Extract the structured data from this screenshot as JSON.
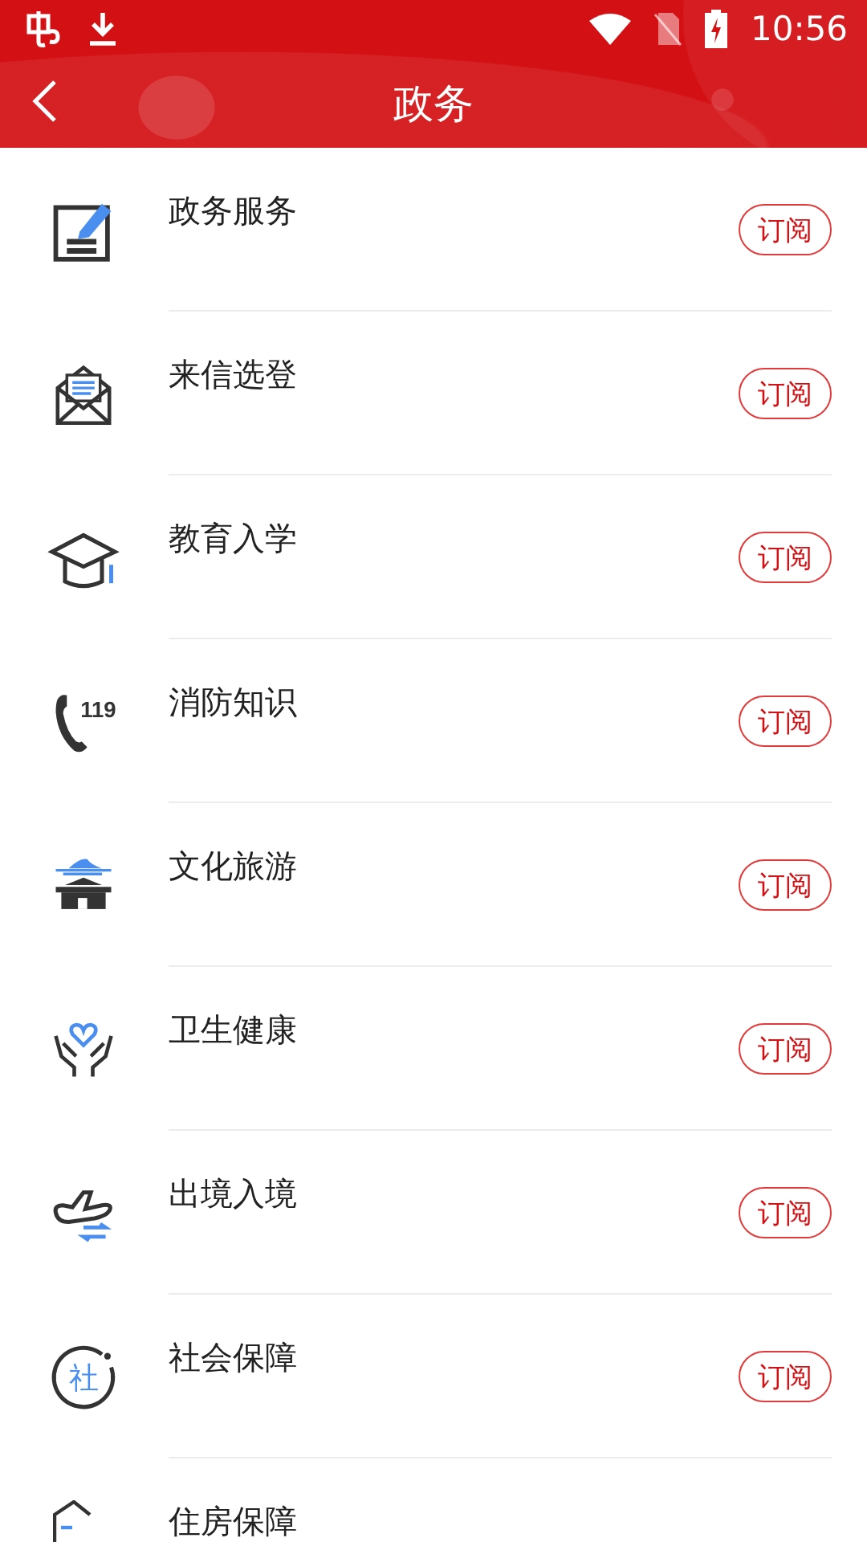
{
  "status_bar": {
    "time": "10:56"
  },
  "header": {
    "title": "政务"
  },
  "items": [
    {
      "title": "政务服务",
      "kind": "form",
      "button": "订阅"
    },
    {
      "title": "来信选登",
      "kind": "letter",
      "button": "订阅"
    },
    {
      "title": "教育入学",
      "kind": "cap",
      "button": "订阅"
    },
    {
      "title": "消防知识",
      "kind": "phone",
      "icon_text": "119",
      "button": "订阅"
    },
    {
      "title": "文化旅游",
      "kind": "temple",
      "button": "订阅"
    },
    {
      "title": "卫生健康",
      "kind": "hands",
      "button": "订阅"
    },
    {
      "title": "出境入境",
      "kind": "plane",
      "button": "订阅"
    },
    {
      "title": "社会保障",
      "kind": "circle",
      "icon_text": "社",
      "button": "订阅"
    },
    {
      "title": "住房保障",
      "kind": "house"
    }
  ]
}
